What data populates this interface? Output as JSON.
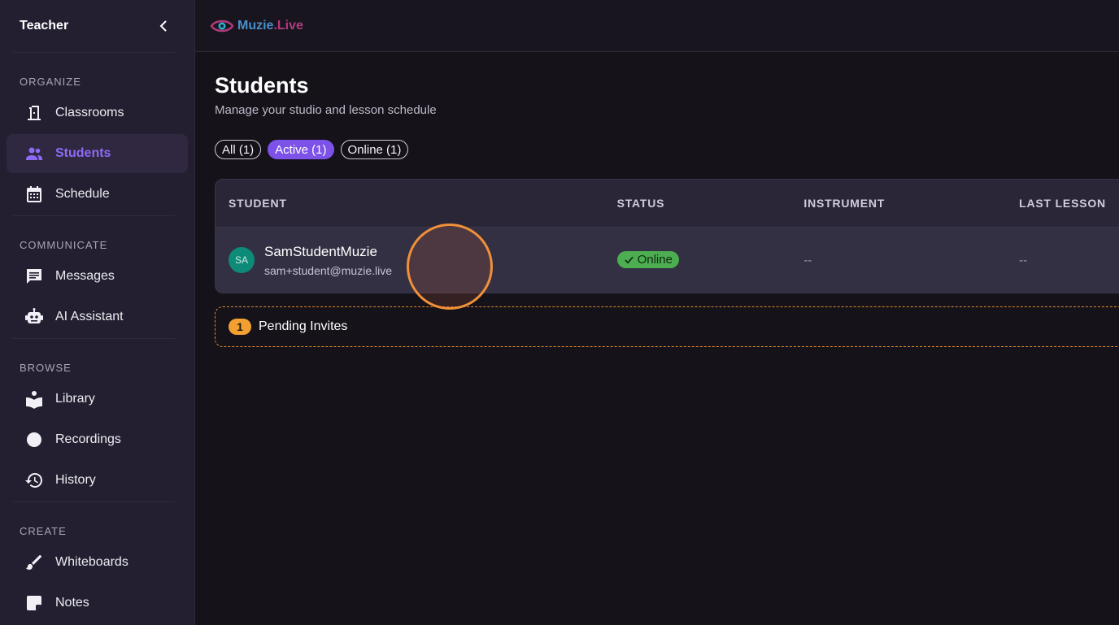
{
  "sidebar": {
    "title": "Teacher",
    "sections": [
      {
        "title": "ORGANIZE",
        "items": [
          {
            "label": "Classrooms",
            "icon": "door-icon"
          },
          {
            "label": "Students",
            "icon": "people-icon",
            "active": true
          },
          {
            "label": "Schedule",
            "icon": "calendar-icon"
          }
        ]
      },
      {
        "title": "COMMUNICATE",
        "items": [
          {
            "label": "Messages",
            "icon": "message-icon"
          },
          {
            "label": "AI Assistant",
            "icon": "robot-icon"
          }
        ]
      },
      {
        "title": "BROWSE",
        "items": [
          {
            "label": "Library",
            "icon": "book-icon"
          },
          {
            "label": "Recordings",
            "icon": "record-icon"
          },
          {
            "label": "History",
            "icon": "history-icon"
          }
        ]
      },
      {
        "title": "CREATE",
        "items": [
          {
            "label": "Whiteboards",
            "icon": "brush-icon"
          },
          {
            "label": "Notes",
            "icon": "note-icon"
          }
        ]
      }
    ]
  },
  "topbar": {
    "logo_text": "Muzie",
    "logo_dot": ".Live"
  },
  "page": {
    "title": "Students",
    "subtitle": "Manage your studio and lesson schedule"
  },
  "filters": [
    {
      "label": "All (1)",
      "active": false
    },
    {
      "label": "Active (1)",
      "active": true
    },
    {
      "label": "Online (1)",
      "active": false
    }
  ],
  "table": {
    "headers": {
      "student": "STUDENT",
      "status": "STATUS",
      "instrument": "INSTRUMENT",
      "last_lesson": "LAST LESSON"
    },
    "rows": [
      {
        "initials": "SA",
        "name": "SamStudentMuzie",
        "email": "sam+student@muzie.live",
        "status": "Online",
        "instrument": "--",
        "last_lesson": "--"
      }
    ]
  },
  "pending": {
    "count": "1",
    "label": "Pending Invites"
  },
  "colors": {
    "accent": "#7c52e8",
    "online": "#4cae50",
    "pending": "#f2a032"
  }
}
